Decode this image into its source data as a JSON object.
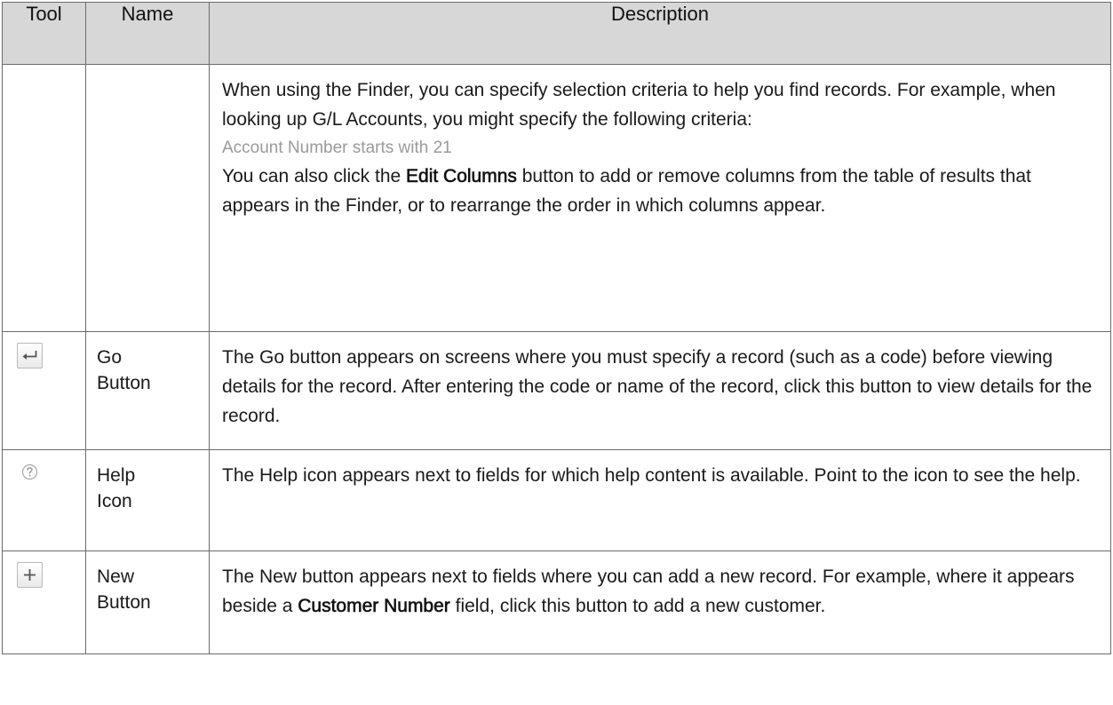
{
  "header": {
    "tool": "Tool",
    "name": "Name",
    "description": "Description"
  },
  "rows": [
    {
      "name": "",
      "description_intro": "When using the Finder, you can specify selection criteria to help you find records. For example, when looking up G/L Accounts, you might specify the following criteria:",
      "criteria": "Account Number starts with 21",
      "edit_pre": "You can also click the ",
      "edit_bold": "Edit Columns",
      "edit_post": " button to add or remove columns from the table of results that appears in the Finder, or to rearrange the order in which columns appear."
    },
    {
      "icon": "enter-return-icon",
      "name_line1": "Go",
      "name_line2": "Button",
      "description": "The Go button appears on screens where you must specify a record (such as a code) before viewing details for the record. After entering the code or name of the record, click this button to view details for the record."
    },
    {
      "icon": "help-circle-icon",
      "name_line1": "Help",
      "name_line2": "Icon",
      "description": "The Help icon appears next to fields for which help content is available. Point to the icon to see the help."
    },
    {
      "icon": "plus-icon",
      "name_line1": "New",
      "name_line2": "Button",
      "desc_pre": "The New button appears next to fields where you can add a new record. For example, where it appears beside a ",
      "desc_bold": "Customer Number",
      "desc_post": " field, click this button to add a new customer."
    }
  ]
}
